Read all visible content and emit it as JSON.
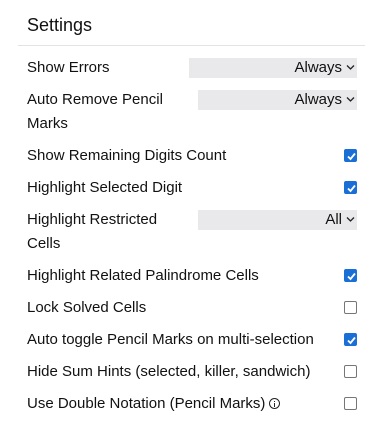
{
  "settings": {
    "title": "Settings",
    "show_errors": {
      "label": "Show Errors",
      "value": "Always"
    },
    "auto_remove": {
      "label": "Auto Remove Pencil Marks",
      "value": "Always"
    },
    "remaining_digits": {
      "label": "Show Remaining Digits Count",
      "checked": true
    },
    "highlight_selected": {
      "label": "Highlight Selected Digit",
      "checked": true
    },
    "highlight_restricted": {
      "label": "Highlight Restricted Cells",
      "value": "All"
    },
    "highlight_palindrome": {
      "label": "Highlight Related Palindrome Cells",
      "checked": true
    },
    "lock_solved": {
      "label": "Lock Solved Cells",
      "checked": false
    },
    "auto_toggle": {
      "label": "Auto toggle Pencil Marks on multi-selection",
      "checked": true
    },
    "hide_sum_hints": {
      "label": "Hide Sum Hints (selected, killer, sandwich)",
      "checked": false
    },
    "double_notation": {
      "label": "Use Double Notation (Pencil Marks)",
      "checked": false
    }
  },
  "colors": {
    "checkbox_accent": "#1a6fd6",
    "select_background": "#e9e9ec"
  },
  "icons": {
    "chevron": "chevron-down-icon",
    "check": "check-icon",
    "info": "info-icon"
  }
}
